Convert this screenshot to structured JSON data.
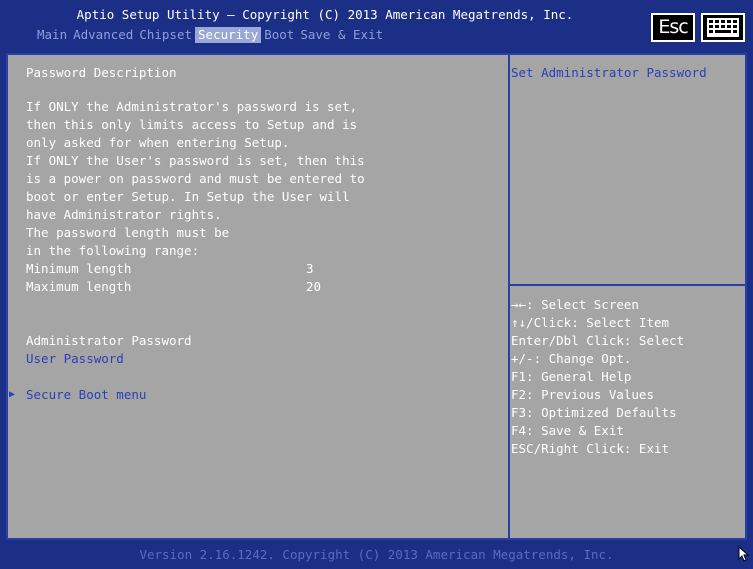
{
  "header": {
    "title": "Aptio Setup Utility – Copyright (C) 2013 American Megatrends, Inc.",
    "tabs": [
      {
        "label": "Main"
      },
      {
        "label": "Advanced"
      },
      {
        "label": "Chipset"
      },
      {
        "label": "Security"
      },
      {
        "label": "Boot"
      },
      {
        "label": "Save & Exit"
      }
    ],
    "active_tab": "Security",
    "esc_label": "Esc"
  },
  "main": {
    "section_title": "Password Description",
    "description": [
      "If ONLY the Administrator's password is set,",
      "then this only limits access to Setup and is",
      "only asked for when entering Setup.",
      "If ONLY the User's password is set, then this",
      "is a power on password and must be entered to",
      "boot or enter Setup. In Setup the User will",
      "have Administrator rights.",
      "The password length must be",
      "in the following range:"
    ],
    "min_label": "Minimum length",
    "min_value": "3",
    "max_label": "Maximum length",
    "max_value": "20",
    "admin_password_label": "Administrator Password",
    "user_password_label": "User Password",
    "secure_boot_arrow": "▶",
    "secure_boot_label": "Secure Boot menu"
  },
  "help": {
    "item_help": "Set Administrator Password",
    "keys": [
      "→←: Select Screen",
      "↑↓/Click: Select Item",
      "Enter/Dbl Click: Select",
      "+/-: Change Opt.",
      "F1: General Help",
      "F2: Previous Values",
      "F3: Optimized Defaults",
      "F4: Save & Exit",
      "ESC/Right Click: Exit"
    ]
  },
  "footer": {
    "version": "Version 2.16.1242. Copyright (C) 2013 American Megatrends, Inc."
  },
  "colors": {
    "header_bg": "#1b2f87",
    "panel_bg": "#a5a5a5",
    "text_white": "#ffffff",
    "highlight_blue": "#2b3fb8",
    "tab_active_bg": "#9aa8d8"
  }
}
